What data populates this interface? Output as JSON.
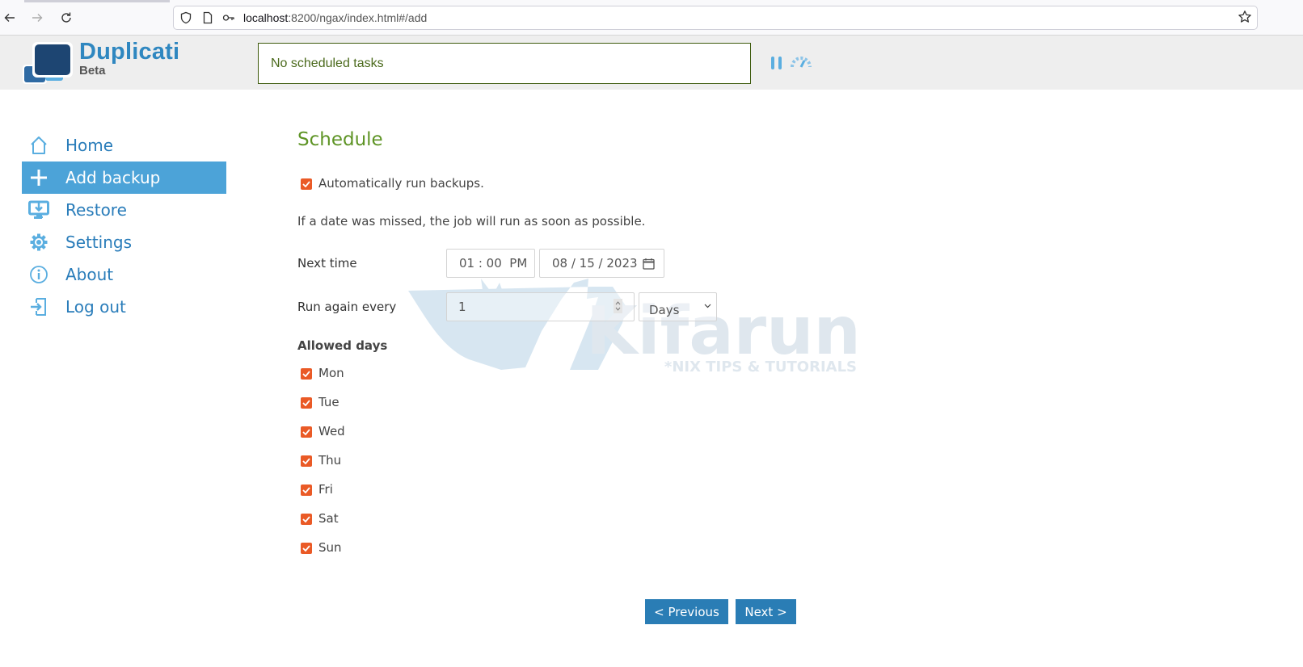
{
  "browser": {
    "url_host": "localhost",
    "url_rest": ":8200/ngax/index.html#/add",
    "back_icon": "arrow-left-icon",
    "forward_icon": "arrow-right-icon",
    "reload_icon": "reload-icon",
    "bookmark_icon": "star-icon"
  },
  "header": {
    "app_name": "Duplicati",
    "app_subtitle": "Beta",
    "status": "No scheduled tasks",
    "colors": {
      "brand": "#2f87c0",
      "status_border": "#3d5a0c"
    }
  },
  "sidebar": {
    "items": [
      {
        "label": "Home",
        "icon": "home-icon",
        "active": false
      },
      {
        "label": "Add backup",
        "icon": "plus-icon",
        "active": true
      },
      {
        "label": "Restore",
        "icon": "restore-icon",
        "active": false
      },
      {
        "label": "Settings",
        "icon": "gear-icon",
        "active": false
      },
      {
        "label": "About",
        "icon": "info-icon",
        "active": false
      },
      {
        "label": "Log out",
        "icon": "logout-icon",
        "active": false
      }
    ],
    "active_color": "#4ca3d8"
  },
  "schedule": {
    "title": "Schedule",
    "auto_run_label": "Automatically run backups.",
    "auto_run_checked": true,
    "missed_note": "If a date was missed, the job will run as soon as possible.",
    "next_time_label": "Next time",
    "next_time_value": "01 : 00  PM",
    "next_date_value": "08 / 15 / 2023",
    "run_again_label": "Run again every",
    "run_again_value": "1",
    "run_again_unit": "Days",
    "allowed_days_label": "Allowed days",
    "days": [
      {
        "label": "Mon",
        "checked": true
      },
      {
        "label": "Tue",
        "checked": true
      },
      {
        "label": "Wed",
        "checked": true
      },
      {
        "label": "Thu",
        "checked": true
      },
      {
        "label": "Fri",
        "checked": true
      },
      {
        "label": "Sat",
        "checked": true
      },
      {
        "label": "Sun",
        "checked": true
      }
    ],
    "checkbox_color": "#ea5a26"
  },
  "footer": {
    "previous_label": "< Previous",
    "next_label": "Next >"
  },
  "watermark": {
    "brand": "Kifarunix",
    "tagline": "*NIX TIPS & TUTORIALS"
  }
}
